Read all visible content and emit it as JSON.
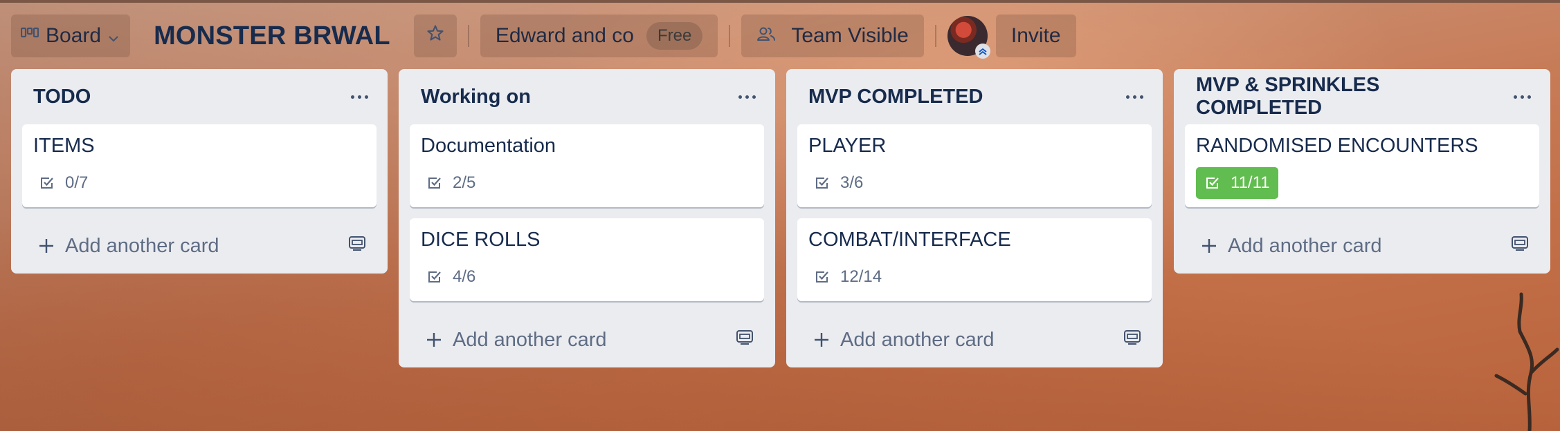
{
  "header": {
    "view_label": "Board",
    "board_title": "MONSTER BRWAL",
    "workspace_name": "Edward and co",
    "workspace_plan": "Free",
    "visibility_label": "Team Visible",
    "invite_label": "Invite"
  },
  "lists": [
    {
      "title": "TODO",
      "cards": [
        {
          "title": "ITEMS",
          "checklist": "0/7",
          "complete": false
        }
      ],
      "add_label": "Add another card"
    },
    {
      "title": "Working on",
      "cards": [
        {
          "title": "Documentation",
          "checklist": "2/5",
          "complete": false
        },
        {
          "title": "DICE ROLLS",
          "checklist": "4/6",
          "complete": false
        }
      ],
      "add_label": "Add another card"
    },
    {
      "title": "MVP COMPLETED",
      "cards": [
        {
          "title": "PLAYER",
          "checklist": "3/6",
          "complete": false
        },
        {
          "title": "COMBAT/INTERFACE",
          "checklist": "12/14",
          "complete": false
        }
      ],
      "add_label": "Add another card"
    },
    {
      "title": "MVP & SPRINKLES COMPLETED",
      "cards": [
        {
          "title": "RANDOMISED ENCOUNTERS",
          "checklist": "11/11",
          "complete": true
        }
      ],
      "add_label": "Add another card"
    }
  ],
  "colors": {
    "list_bg": "#ebecf0",
    "text_primary": "#172b4d",
    "text_muted": "#5e6c84",
    "complete_badge": "#61bd4f"
  },
  "icons": {
    "view": "board-columns-icon",
    "chevron": "chevron-down-icon",
    "star": "star-icon",
    "visibility": "team-visible-icon",
    "checklist": "checklist-icon",
    "add": "plus-icon",
    "template": "card-template-icon",
    "list_menu": "more-dots-icon"
  }
}
